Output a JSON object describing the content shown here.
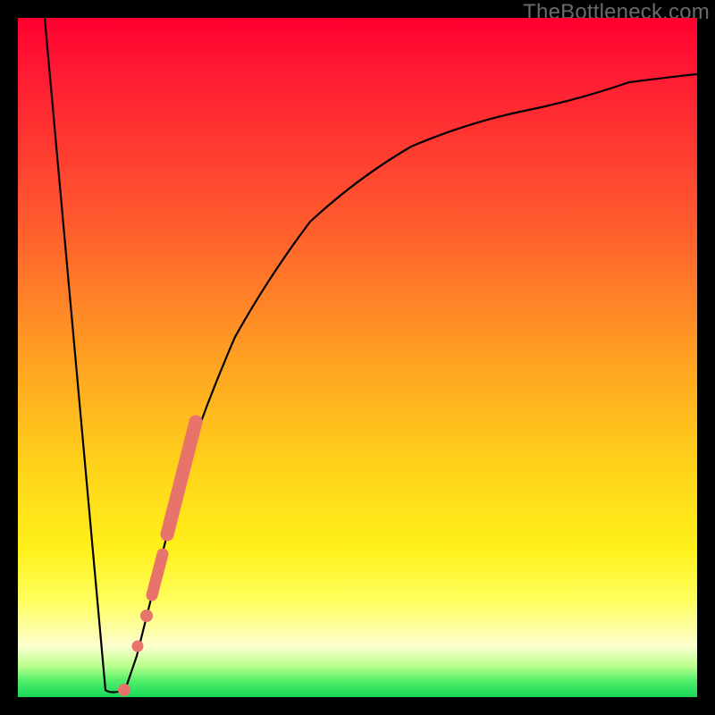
{
  "watermark": "TheBottleneck.com",
  "colors": {
    "curve": "#000000",
    "marker": "#e8736b",
    "background_frame": "#000000"
  },
  "chart_data": {
    "type": "line",
    "title": "",
    "xlabel": "",
    "ylabel": "",
    "xlim": [
      0,
      100
    ],
    "ylim": [
      0,
      100
    ],
    "grid": false,
    "legend": false,
    "note": "Values estimated from pixel positions of an unlabeled axes chart; x and y in 0–100 relative units.",
    "series": [
      {
        "name": "left-branch",
        "x": [
          4,
          5,
          6,
          7,
          8,
          9,
          10,
          10.8,
          11.5,
          12.2,
          12.8
        ],
        "y": [
          100,
          88,
          76,
          64,
          52,
          40,
          28,
          18,
          10,
          4,
          1
        ]
      },
      {
        "name": "valley",
        "x": [
          12.8,
          13.6,
          14.6,
          15.8
        ],
        "y": [
          1,
          0.6,
          0.6,
          1.2
        ]
      },
      {
        "name": "right-branch",
        "x": [
          15.8,
          17.5,
          19.5,
          22,
          25,
          28,
          32,
          37,
          43,
          50,
          58,
          66,
          74,
          82,
          90,
          98,
          100
        ],
        "y": [
          1.2,
          6,
          14,
          24,
          35,
          44,
          53,
          62,
          70,
          76.5,
          81.5,
          85,
          87.5,
          89.3,
          90.6,
          91.5,
          91.7
        ]
      }
    ],
    "markers": [
      {
        "name": "cluster-segment-top",
        "shape": "rounded-bar",
        "x": [
          22.0,
          26.2
        ],
        "y": [
          24.0,
          40.5
        ]
      },
      {
        "name": "cluster-segment-mid",
        "shape": "rounded-bar",
        "x": [
          19.8,
          21.3
        ],
        "y": [
          15.0,
          21.0
        ]
      },
      {
        "name": "cluster-dot-a",
        "shape": "dot",
        "x": 19.0,
        "y": 12.0
      },
      {
        "name": "cluster-dot-b",
        "shape": "dot",
        "x": 17.6,
        "y": 7.5
      },
      {
        "name": "cluster-dot-c",
        "shape": "dot",
        "x": 15.6,
        "y": 1.0
      }
    ]
  }
}
